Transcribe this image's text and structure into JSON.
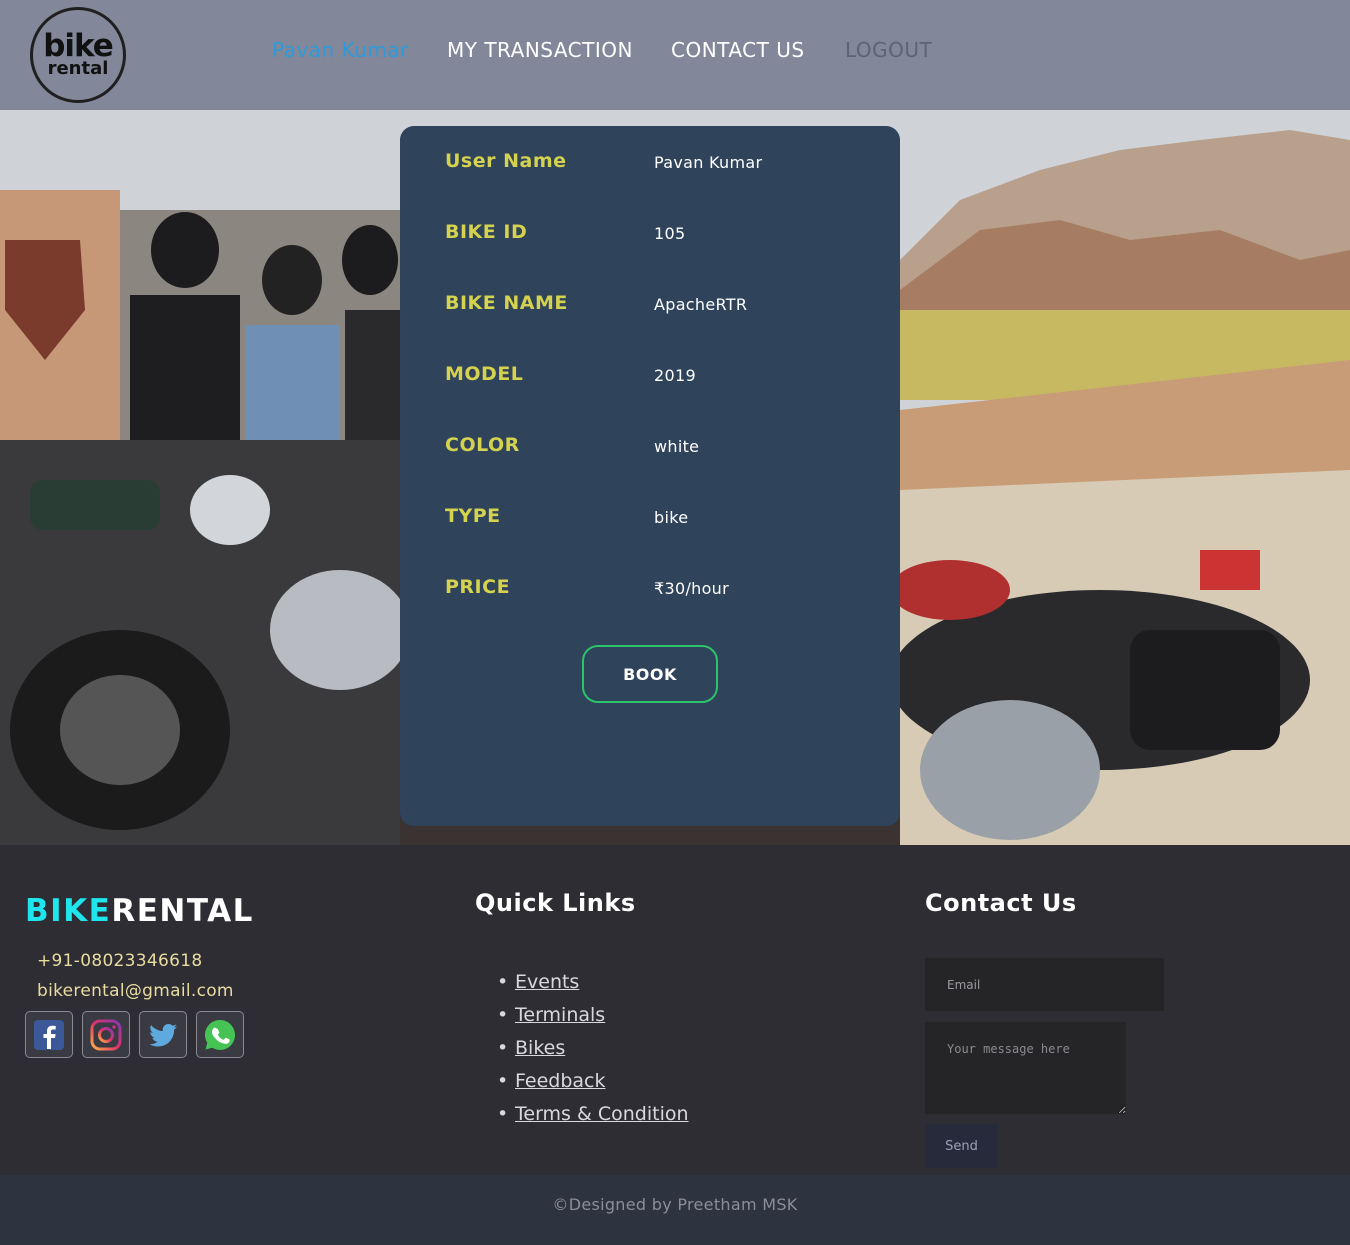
{
  "header": {
    "logo": {
      "line1": "bike",
      "line2": "rental"
    },
    "nav": {
      "user": "Pavan Kumar",
      "transactions": "MY TRANSACTION",
      "contact": "CONTACT US",
      "logout": "LOGOUT"
    }
  },
  "card": {
    "rows": [
      {
        "label": "User Name",
        "value": "Pavan Kumar"
      },
      {
        "label": "BIKE ID",
        "value": "105"
      },
      {
        "label": "BIKE NAME",
        "value": "ApacheRTR"
      },
      {
        "label": "MODEL",
        "value": "2019"
      },
      {
        "label": "COLOR",
        "value": "white"
      },
      {
        "label": "TYPE",
        "value": "bike"
      },
      {
        "label": "PRICE",
        "value": "₹30/hour"
      }
    ],
    "book_label": "BOOK"
  },
  "footer": {
    "brand": {
      "part1": "BIKE",
      "part2": "RENTAL"
    },
    "phone": "+91-08023346618",
    "email": "bikerental@gmail.com",
    "social_icons": [
      "facebook-icon",
      "instagram-icon",
      "twitter-icon",
      "whatsapp-icon"
    ],
    "quick_links": {
      "title": "Quick Links",
      "items": [
        "Events",
        "Terminals",
        "Bikes",
        "Feedback",
        "Terms & Condition"
      ]
    },
    "contact": {
      "title": "Contact Us",
      "email_placeholder": "Email",
      "message_placeholder": "Your message here",
      "send_label": "Send"
    },
    "credit": "©Designed by Preetham MSK"
  },
  "colors": {
    "header_bg": "#828899",
    "card_bg": "#2f435a",
    "label": "#d4d24e",
    "accent_cyan": "#1fe6ec",
    "book_border": "#2bc36c",
    "nav_active": "#2f9ad9"
  }
}
